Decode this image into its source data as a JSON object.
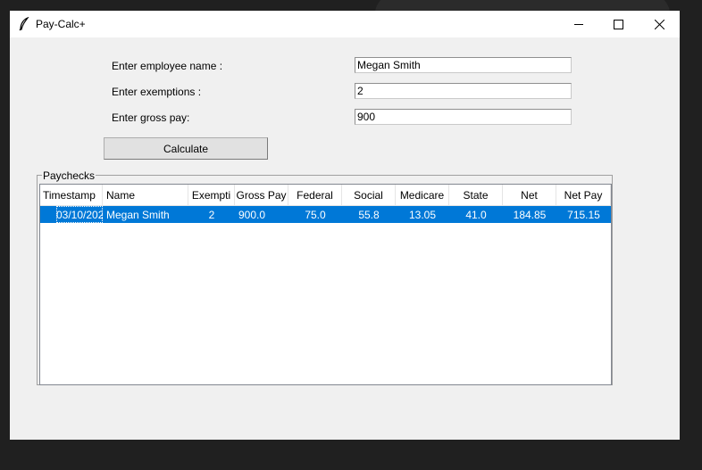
{
  "window": {
    "title": "Pay-Calc+"
  },
  "form": {
    "name_label": "Enter employee name :",
    "name_value": "Megan Smith",
    "exemptions_label": "Enter exemptions :",
    "exemptions_value": "2",
    "gross_label": "Enter gross pay:",
    "gross_value": "900",
    "calculate_label": "Calculate"
  },
  "paychecks": {
    "frame_label": "Paychecks",
    "columns": [
      "Timestamp",
      "Name",
      "Exempti",
      "Gross Pay",
      "Federal",
      "Social",
      "Medicare",
      "State",
      "Net",
      "Net Pay"
    ],
    "rows": [
      [
        "03/10/202",
        "Megan Smith",
        "2",
        "900.0",
        "75.0",
        "55.8",
        "13.05",
        "41.0",
        "184.85",
        "715.15"
      ]
    ]
  },
  "colors": {
    "selection": "#0078d7",
    "window_bg": "#f0f0f0",
    "desktop_bg": "#202020"
  },
  "icons": [
    "feather-icon",
    "minimize-icon",
    "maximize-icon",
    "close-icon"
  ]
}
